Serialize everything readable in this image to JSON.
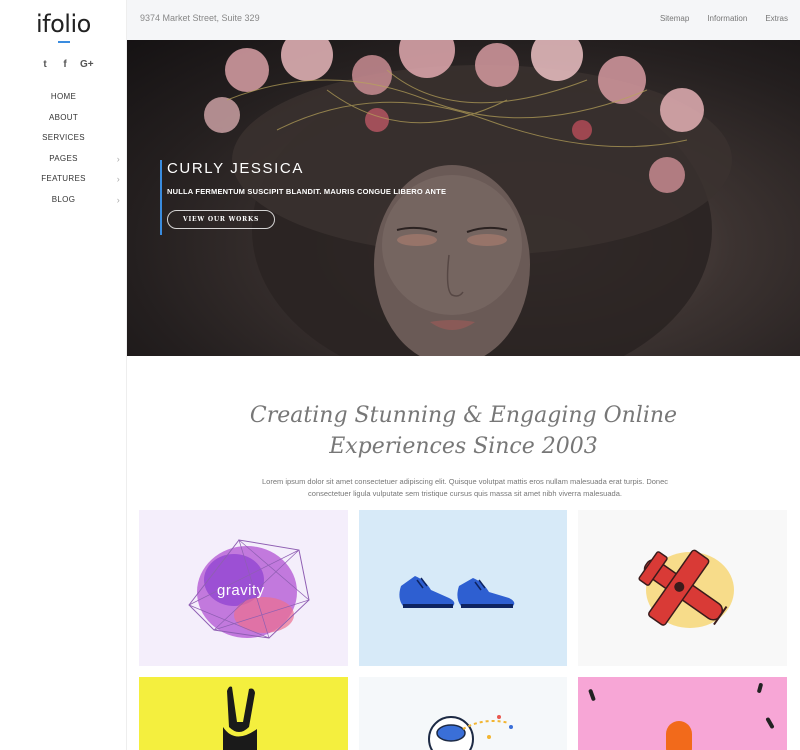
{
  "logo": {
    "text": "ifolio"
  },
  "social": {
    "twitter": "t",
    "facebook": "f",
    "google": "G+"
  },
  "nav": {
    "items": [
      {
        "label": "HOME",
        "has_children": false
      },
      {
        "label": "ABOUT",
        "has_children": false
      },
      {
        "label": "SERVICES",
        "has_children": false
      },
      {
        "label": "PAGES",
        "has_children": true
      },
      {
        "label": "FEATURES",
        "has_children": true
      },
      {
        "label": "BLOG",
        "has_children": true
      }
    ],
    "chevron": "›"
  },
  "topbar": {
    "address": "9374 Market Street, Suite 329",
    "links": [
      "Sitemap",
      "Information",
      "Extras"
    ]
  },
  "hero": {
    "title": "CURLY JESSICA",
    "subtitle": "NULLA FERMENTUM SUSCIPIT BLANDIT. MAURIS CONGUE LIBERO ANTE",
    "button": "VIEW OUR WORKS"
  },
  "headline": {
    "line1": "Creating Stunning & Engaging Online",
    "line2": "Experiences Since 2003"
  },
  "lead": {
    "line1": "Lorem ipsum dolor sit amet consectetuer adipiscing elit. Quisque volutpat mattis eros nullam malesuada erat turpis. Donec",
    "line2": "consectetuer ligula vulputate sem tristique cursus quis massa sit amet nibh viverra malesuada."
  },
  "portfolio": {
    "tile1_word": "gravity"
  },
  "colors": {
    "accent": "#3a8cdf",
    "topbar_bg": "#f5f6f8"
  }
}
